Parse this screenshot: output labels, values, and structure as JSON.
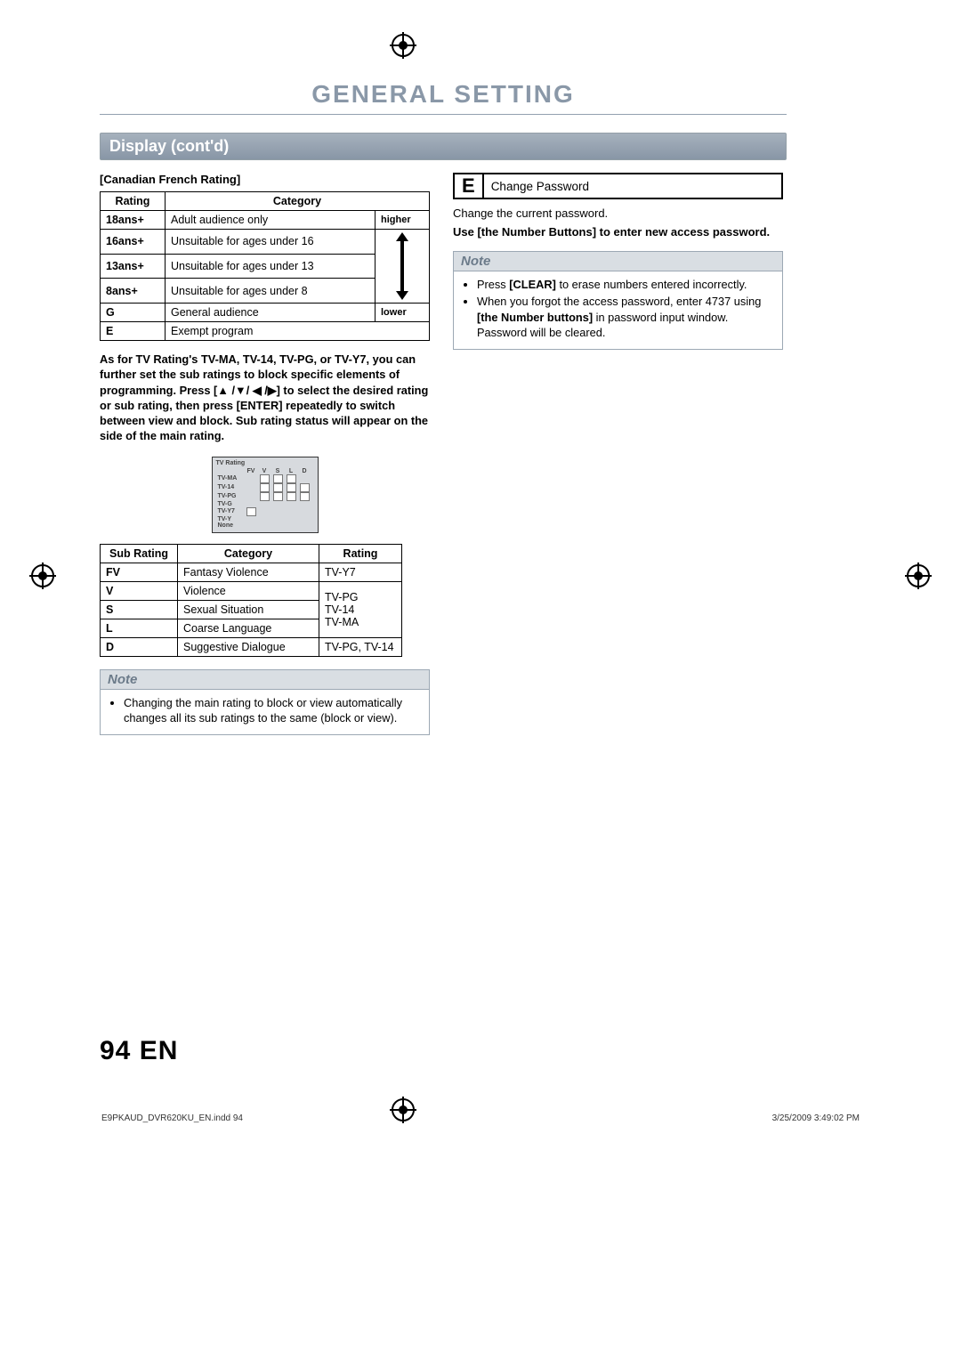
{
  "title": "GENERAL SETTING",
  "section": "Display (cont'd)",
  "left": {
    "heading": "[Canadian French Rating]",
    "table1": {
      "headers": [
        "Rating",
        "Category"
      ],
      "rows": [
        {
          "rating": "18ans+",
          "category": "Adult audience only"
        },
        {
          "rating": "16ans+",
          "category": "Unsuitable for ages under 16"
        },
        {
          "rating": "13ans+",
          "category": "Unsuitable for ages under 13"
        },
        {
          "rating": "8ans+",
          "category": "Unsuitable for ages under 8"
        },
        {
          "rating": "G",
          "category": "General audience"
        },
        {
          "rating": "E",
          "category": "Exempt program"
        }
      ],
      "higher": "higher",
      "lower": "lower"
    },
    "bold_para": "As for TV Rating's TV-MA, TV-14, TV-PG, or TV-Y7, you can further set the sub ratings to block specific elements of programming. Press [▲ /▼/ ◀ /▶] to select the desired rating or sub rating, then press [ENTER] repeatedly to switch between view and block. Sub rating status will appear on the side of the main rating.",
    "tv_rating_grid": {
      "title": "TV Rating",
      "cols": [
        "FV",
        "V",
        "S",
        "L",
        "D"
      ],
      "rows": [
        "TV-MA",
        "TV-14",
        "TV-PG",
        "TV-G",
        "TV-Y7",
        "TV-Y",
        "None"
      ]
    },
    "table2": {
      "headers": [
        "Sub Rating",
        "Category",
        "Rating"
      ],
      "rows": [
        {
          "sub": "FV",
          "cat": "Fantasy Violence",
          "rating": "TV-Y7"
        },
        {
          "sub": "V",
          "cat": "Violence",
          "rating": ""
        },
        {
          "sub": "S",
          "cat": "Sexual Situation",
          "rating": ""
        },
        {
          "sub": "L",
          "cat": "Coarse Language",
          "rating": ""
        },
        {
          "sub": "D",
          "cat": "Suggestive Dialogue",
          "rating": "TV-PG, TV-14"
        }
      ],
      "group_rating": "TV-PG\nTV-14\nTV-MA"
    },
    "note": {
      "head": "Note",
      "items": [
        "Changing the main rating to block or view automatically changes all its sub ratings to the same (block or view)."
      ]
    }
  },
  "right": {
    "e_letter": "E",
    "e_label": "Change Password",
    "p1": "Change the current password.",
    "p2": "Use [the Number Buttons] to enter new access password.",
    "note": {
      "head": "Note",
      "items": [
        "Press [CLEAR] to erase numbers entered incorrectly.",
        "When you forgot the access password, enter 4737 using [the Number buttons] in password input window. Password will be cleared."
      ]
    }
  },
  "footer": {
    "page": "94",
    "lang": "EN",
    "indd": "E9PKAUD_DVR620KU_EN.indd   94",
    "timestamp": "3/25/2009   3:49:02 PM"
  }
}
